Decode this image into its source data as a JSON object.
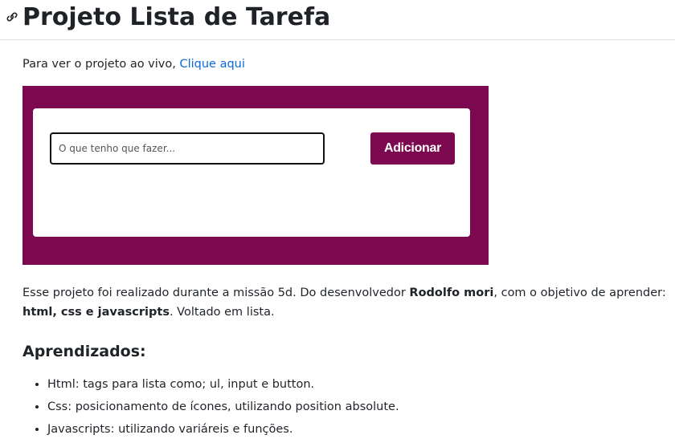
{
  "header": {
    "title": "Projeto Lista de Tarefa",
    "anchor_icon": "link-icon"
  },
  "intro": {
    "text": "Para ver o projeto ao vivo, ",
    "link_label": "Clique aqui"
  },
  "preview": {
    "background_color": "#7c0950",
    "input_placeholder": "O que tenho que fazer...",
    "add_button_label": "Adicionar"
  },
  "description": {
    "part1": "Esse projeto foi realizado durante a missão 5d. Do desenvolvedor ",
    "author": "Rodolfo mori",
    "part2": ", com o objetivo de aprender: ",
    "tech": "html, css e javascripts",
    "part3": ". Voltado em lista."
  },
  "learnings": {
    "heading": "Aprendizados:",
    "items": [
      "Html: tags para lista como; ul, input e button.",
      "Css: posicionamento de ícones, utilizando position absolute.",
      "Javascripts: utilizando variáreis e funções."
    ]
  },
  "colors": {
    "link": "#0969da",
    "text": "#1f2328",
    "accent": "#7c0950"
  }
}
